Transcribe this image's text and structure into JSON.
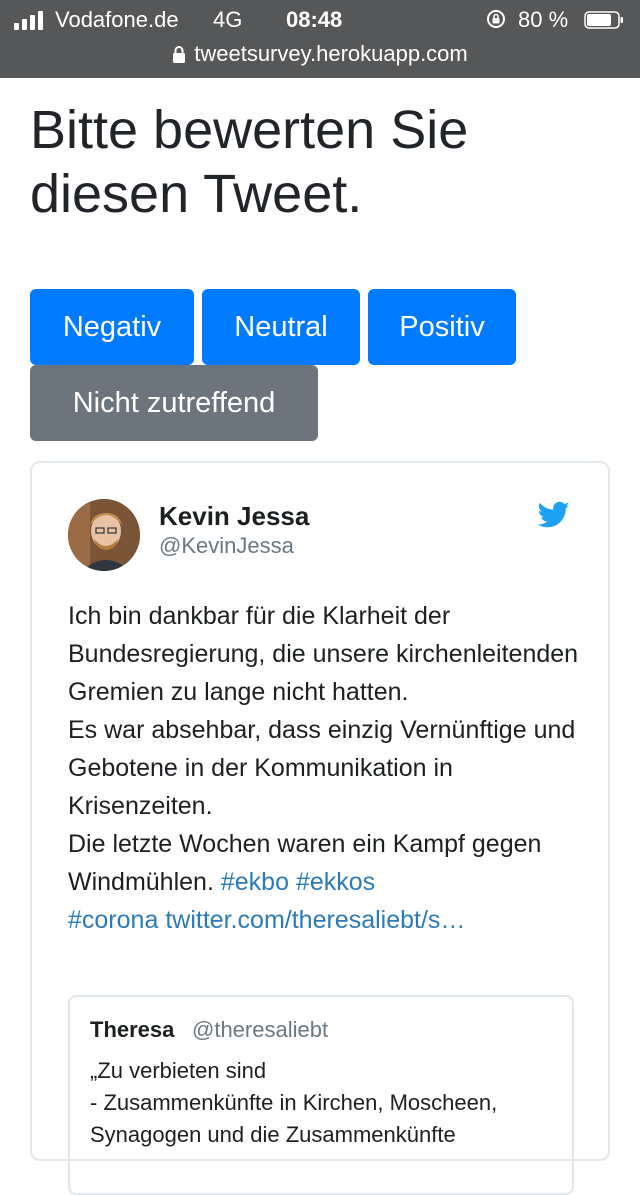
{
  "status_bar": {
    "carrier": "Vodafone.de",
    "network": "4G",
    "time": "08:48",
    "battery": "80 %",
    "battery_level": 0.8
  },
  "address_bar": {
    "url": "tweetsurvey.herokuapp.com"
  },
  "page": {
    "heading": "Bitte bewerten Sie diesen Tweet."
  },
  "rating_buttons": {
    "negative": "Negativ",
    "neutral": "Neutral",
    "positive": "Positiv",
    "not_applicable": "Nicht zutreffend"
  },
  "colors": {
    "primary": "#007bff",
    "secondary": "#6c757d",
    "link": "#2b7bb9",
    "twitter": "#1da1f2"
  },
  "tweet": {
    "author_name": "Kevin Jessa",
    "author_handle": "@KevinJessa",
    "text": "Ich bin dankbar für die Klarheit der Bundesregierung, die unsere kirchenleitenden Gremien zu lange nicht hatten.\nEs war absehbar, dass einzig Vernünftige und Gebotene in der Kommunikation in Krisenzeiten.\nDie letzte Wochen waren ein Kampf gegen Windmühlen. ",
    "hashtags": [
      "#ekbo",
      "#ekkos",
      "#corona"
    ],
    "link": "twitter.com/theresaliebt/s…",
    "quoted": {
      "name": "Theresa",
      "handle": "@theresaliebt",
      "text": "„Zu verbieten sind\n - Zusammenkünfte in Kirchen, Moscheen, Synagogen und die Zusammenkünfte"
    }
  }
}
